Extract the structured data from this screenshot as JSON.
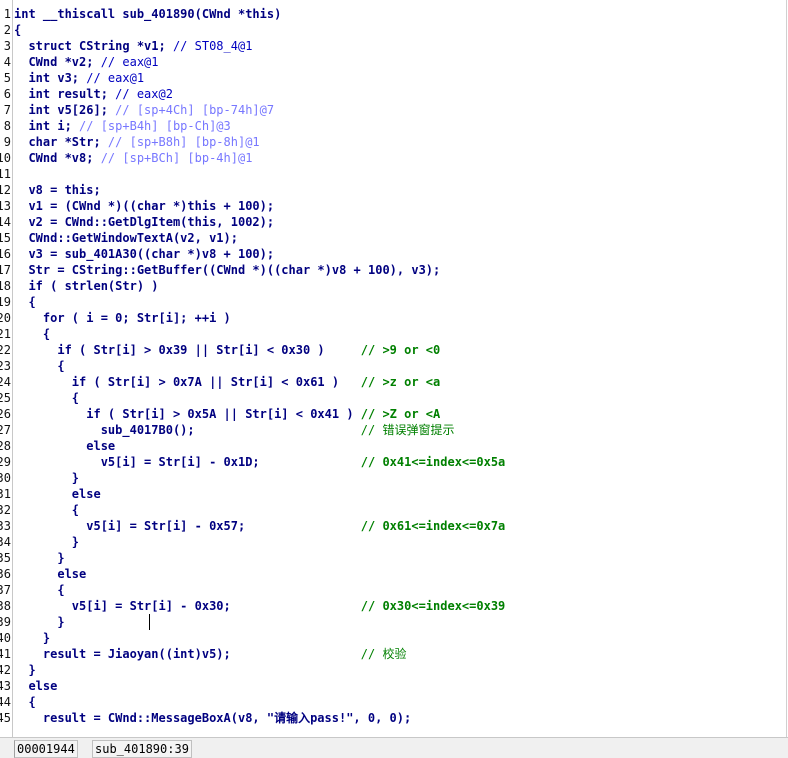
{
  "editor": {
    "lines": [
      {
        "n": "1",
        "segs": [
          {
            "t": "int __thiscall sub_401890(CWnd *this)",
            "c": "pl"
          }
        ]
      },
      {
        "n": "2",
        "segs": [
          {
            "t": "{",
            "c": "pl"
          }
        ]
      },
      {
        "n": "3",
        "segs": [
          {
            "t": "  struct CString *v1; ",
            "c": "pl"
          },
          {
            "t": "// ST08_4@1",
            "c": "cm"
          }
        ]
      },
      {
        "n": "4",
        "segs": [
          {
            "t": "  CWnd *v2; ",
            "c": "pl"
          },
          {
            "t": "// eax@1",
            "c": "cm"
          }
        ]
      },
      {
        "n": "5",
        "segs": [
          {
            "t": "  int v3; ",
            "c": "pl"
          },
          {
            "t": "// eax@1",
            "c": "cm"
          }
        ]
      },
      {
        "n": "6",
        "segs": [
          {
            "t": "  int result; ",
            "c": "pl"
          },
          {
            "t": "// eax@2",
            "c": "cm"
          }
        ]
      },
      {
        "n": "7",
        "segs": [
          {
            "t": "  int v5[26]; ",
            "c": "pl"
          },
          {
            "t": "// [sp+4Ch] [bp-74h]@7",
            "c": "cm3"
          }
        ]
      },
      {
        "n": "8",
        "segs": [
          {
            "t": "  int i; ",
            "c": "pl"
          },
          {
            "t": "// [sp+B4h] [bp-Ch]@3",
            "c": "cm3"
          }
        ]
      },
      {
        "n": "9",
        "segs": [
          {
            "t": "  char *Str; ",
            "c": "pl"
          },
          {
            "t": "// [sp+B8h] [bp-8h]@1",
            "c": "cm3"
          }
        ]
      },
      {
        "n": "10",
        "segs": [
          {
            "t": "  CWnd *v8; ",
            "c": "pl"
          },
          {
            "t": "// [sp+BCh] [bp-4h]@1",
            "c": "cm3"
          }
        ]
      },
      {
        "n": "11",
        "segs": [
          {
            "t": "",
            "c": "pl"
          }
        ]
      },
      {
        "n": "12",
        "segs": [
          {
            "t": "  v8 = this;",
            "c": "pl"
          }
        ]
      },
      {
        "n": "13",
        "segs": [
          {
            "t": "  v1 = (CWnd *)((char *)this + 100);",
            "c": "pl"
          }
        ]
      },
      {
        "n": "14",
        "segs": [
          {
            "t": "  v2 = CWnd::GetDlgItem(this, 1002);",
            "c": "pl"
          }
        ]
      },
      {
        "n": "15",
        "segs": [
          {
            "t": "  CWnd::GetWindowTextA(v2, v1);",
            "c": "pl"
          }
        ]
      },
      {
        "n": "16",
        "segs": [
          {
            "t": "  v3 = sub_401A30((char *)v8 + 100);",
            "c": "pl"
          }
        ]
      },
      {
        "n": "17",
        "segs": [
          {
            "t": "  Str = CString::GetBuffer((CWnd *)((char *)v8 + 100), v3);",
            "c": "pl"
          }
        ]
      },
      {
        "n": "18",
        "segs": [
          {
            "t": "  if ( strlen(Str) )",
            "c": "pl"
          }
        ]
      },
      {
        "n": "19",
        "segs": [
          {
            "t": "  {",
            "c": "pl"
          }
        ]
      },
      {
        "n": "20",
        "segs": [
          {
            "t": "    for ( i = 0; Str[i]; ++i )",
            "c": "pl"
          }
        ]
      },
      {
        "n": "21",
        "segs": [
          {
            "t": "    {",
            "c": "pl"
          }
        ]
      },
      {
        "n": "22",
        "segs": [
          {
            "t": "      if ( Str[i] > 0x39 || Str[i] < 0x30 )     ",
            "c": "pl"
          },
          {
            "t": "// >9 or <0",
            "c": "cm2"
          }
        ]
      },
      {
        "n": "23",
        "segs": [
          {
            "t": "      {",
            "c": "pl"
          }
        ]
      },
      {
        "n": "24",
        "segs": [
          {
            "t": "        if ( Str[i] > 0x7A || Str[i] < 0x61 )   ",
            "c": "pl"
          },
          {
            "t": "// >z or <a",
            "c": "cm2"
          }
        ]
      },
      {
        "n": "25",
        "segs": [
          {
            "t": "        {",
            "c": "pl"
          }
        ]
      },
      {
        "n": "26",
        "segs": [
          {
            "t": "          if ( Str[i] > 0x5A || Str[i] < 0x41 ) ",
            "c": "pl"
          },
          {
            "t": "// >Z or <A",
            "c": "cm2"
          }
        ]
      },
      {
        "n": "27",
        "segs": [
          {
            "t": "            sub_4017B0();                       ",
            "c": "pl"
          },
          {
            "t": "// 错误弹窗提示",
            "c": "ch"
          }
        ]
      },
      {
        "n": "28",
        "segs": [
          {
            "t": "          else",
            "c": "pl"
          }
        ]
      },
      {
        "n": "29",
        "segs": [
          {
            "t": "            v5[i] = Str[i] - 0x1D;              ",
            "c": "pl"
          },
          {
            "t": "// 0x41<=index<=0x5a",
            "c": "cm2"
          }
        ]
      },
      {
        "n": "30",
        "segs": [
          {
            "t": "        }",
            "c": "pl"
          }
        ]
      },
      {
        "n": "31",
        "segs": [
          {
            "t": "        else",
            "c": "pl"
          }
        ]
      },
      {
        "n": "32",
        "segs": [
          {
            "t": "        {",
            "c": "pl"
          }
        ]
      },
      {
        "n": "33",
        "segs": [
          {
            "t": "          v5[i] = Str[i] - 0x57;                ",
            "c": "pl"
          },
          {
            "t": "// 0x61<=index<=0x7a",
            "c": "cm2"
          }
        ]
      },
      {
        "n": "34",
        "segs": [
          {
            "t": "        }",
            "c": "pl"
          }
        ]
      },
      {
        "n": "35",
        "segs": [
          {
            "t": "      }",
            "c": "pl"
          }
        ]
      },
      {
        "n": "36",
        "segs": [
          {
            "t": "      else",
            "c": "pl"
          }
        ]
      },
      {
        "n": "37",
        "segs": [
          {
            "t": "      {",
            "c": "pl"
          }
        ]
      },
      {
        "n": "38",
        "segs": [
          {
            "t": "        v5[i] = Str[i] - 0x30;                  ",
            "c": "pl"
          },
          {
            "t": "// 0x30<=index<=0x39",
            "c": "cm2"
          }
        ]
      },
      {
        "n": "39",
        "segs": [
          {
            "t": "      }",
            "c": "pl"
          }
        ]
      },
      {
        "n": "40",
        "segs": [
          {
            "t": "    }",
            "c": "pl"
          }
        ]
      },
      {
        "n": "41",
        "segs": [
          {
            "t": "    result = Jiaoyan((int)v5);                  ",
            "c": "pl"
          },
          {
            "t": "// 校验",
            "c": "ch"
          }
        ]
      },
      {
        "n": "42",
        "segs": [
          {
            "t": "  }",
            "c": "pl"
          }
        ]
      },
      {
        "n": "43",
        "segs": [
          {
            "t": "  else",
            "c": "pl"
          }
        ]
      },
      {
        "n": "44",
        "segs": [
          {
            "t": "  {",
            "c": "pl"
          }
        ]
      },
      {
        "n": "45",
        "segs": [
          {
            "t": "    result = CWnd::MessageBoxA(v8, \"请输入pass!\", 0, 0);",
            "c": "pl"
          }
        ]
      }
    ]
  },
  "status": {
    "address": "00001944",
    "location": "sub_401890:39"
  }
}
